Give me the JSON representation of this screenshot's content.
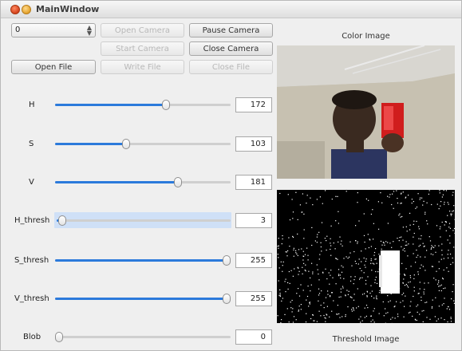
{
  "window": {
    "title": "MainWindow"
  },
  "camera_select": {
    "value": "0"
  },
  "buttons": {
    "open_camera": "Open Camera",
    "pause_camera": "Pause Camera",
    "start_camera": "Start Camera",
    "close_camera": "Close Camera",
    "open_file": "Open File",
    "write_file": "Write File",
    "close_file": "Close File"
  },
  "sliders": [
    {
      "label": "H",
      "value": "172",
      "fraction": 0.64
    },
    {
      "label": "S",
      "value": "103",
      "fraction": 0.4
    },
    {
      "label": "V",
      "value": "181",
      "fraction": 0.71
    },
    {
      "label": "H_thresh",
      "value": "3",
      "fraction": 0.01
    },
    {
      "label": "S_thresh",
      "value": "255",
      "fraction": 1.0
    },
    {
      "label": "V_thresh",
      "value": "255",
      "fraction": 1.0
    },
    {
      "label": "Blob",
      "value": "0",
      "fraction": 0.0
    }
  ],
  "images": {
    "color_label": "Color Image",
    "threshold_label": "Threshold Image"
  },
  "colors": {
    "accent": "#2b7adb",
    "highlight": "#cfe0f7"
  }
}
